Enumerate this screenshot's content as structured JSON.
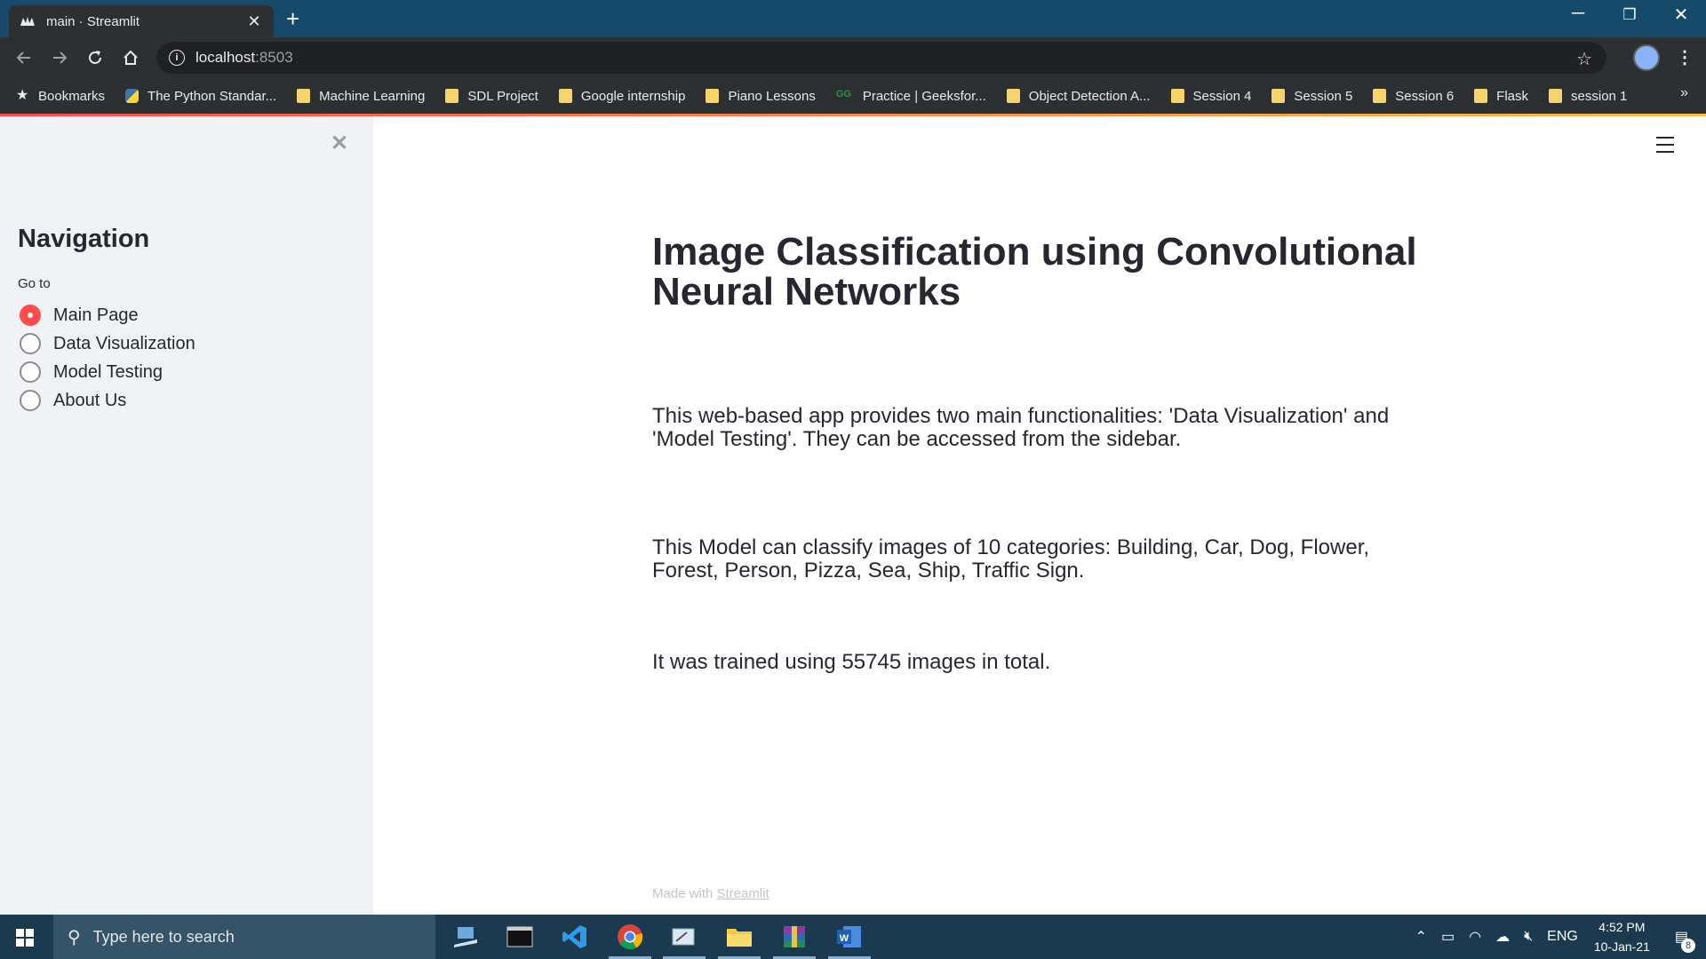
{
  "browser": {
    "tab_title": "main · Streamlit",
    "url_host": "localhost",
    "url_port": ":8503",
    "bookmarks": [
      {
        "label": "Bookmarks",
        "icon": "star-icon"
      },
      {
        "label": "The Python Standar...",
        "icon": "python-icon"
      },
      {
        "label": "Machine Learning",
        "icon": "folder-icon"
      },
      {
        "label": "SDL Project",
        "icon": "folder-icon"
      },
      {
        "label": "Google internship",
        "icon": "folder-icon"
      },
      {
        "label": "Piano Lessons",
        "icon": "folder-icon"
      },
      {
        "label": "Practice | Geeksfor...",
        "icon": "geeksforgeeks-icon"
      },
      {
        "label": "Object Detection A...",
        "icon": "folder-icon"
      },
      {
        "label": "Session 4",
        "icon": "folder-icon"
      },
      {
        "label": "Session 5",
        "icon": "folder-icon"
      },
      {
        "label": "Session 6",
        "icon": "folder-icon"
      },
      {
        "label": "Flask",
        "icon": "folder-icon"
      },
      {
        "label": "session 1",
        "icon": "folder-icon"
      }
    ],
    "more_label": "»"
  },
  "sidebar": {
    "title": "Navigation",
    "radio_label": "Go to",
    "options": [
      {
        "label": "Main Page",
        "selected": true
      },
      {
        "label": "Data Visualization",
        "selected": false
      },
      {
        "label": "Model Testing",
        "selected": false
      },
      {
        "label": "About Us",
        "selected": false
      }
    ]
  },
  "main": {
    "title": "Image Classification using Convolutional Neural Networks",
    "paragraphs": [
      "This web-based app provides two main functionalities: 'Data Visualization' and 'Model Testing'. They can be accessed from the sidebar.",
      "This Model can classify images of 10 categories: Building, Car, Dog, Flower, Forest, Person, Pizza, Sea, Ship, Traffic Sign.",
      "It was trained using 55745 images in total."
    ],
    "footer_prefix": "Made with",
    "footer_link": "Streamlit"
  },
  "taskbar": {
    "search_placeholder": "Type here to search",
    "language": "ENG",
    "time": "4:52 PM",
    "date": "10-Jan-21",
    "notification_count": "8"
  },
  "colors": {
    "accent": "#ff4b4b",
    "sidebar_bg": "#f0f2f6",
    "text": "#262730"
  }
}
